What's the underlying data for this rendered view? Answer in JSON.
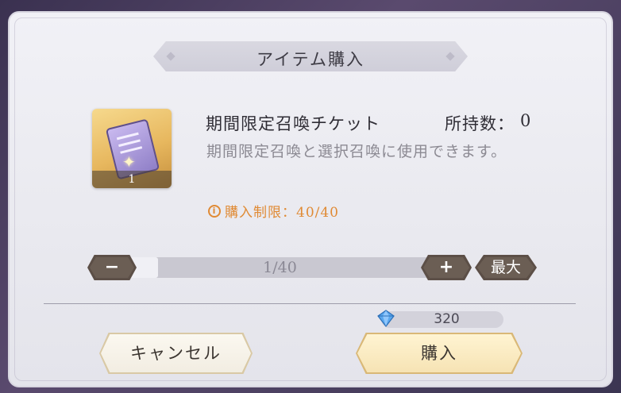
{
  "dialog": {
    "title": "アイテム購入"
  },
  "item": {
    "name": "期間限定召喚チケット",
    "owned_label": "所持数：",
    "owned_value": "0",
    "description": "期間限定召喚と選択召喚に使用できます。",
    "icon_count": "1",
    "icon": "summon-ticket-icon",
    "purchase_limit": "購入制限：40/40",
    "limit_color": "#e08a34"
  },
  "quantity": {
    "value_text": "1/40",
    "current": 1,
    "max": 40,
    "minus_label": "−",
    "plus_label": "+",
    "max_label": "最大"
  },
  "cost": {
    "icon": "gem-icon",
    "value": "320"
  },
  "actions": {
    "cancel_label": "キャンセル",
    "buy_label": "購入"
  }
}
